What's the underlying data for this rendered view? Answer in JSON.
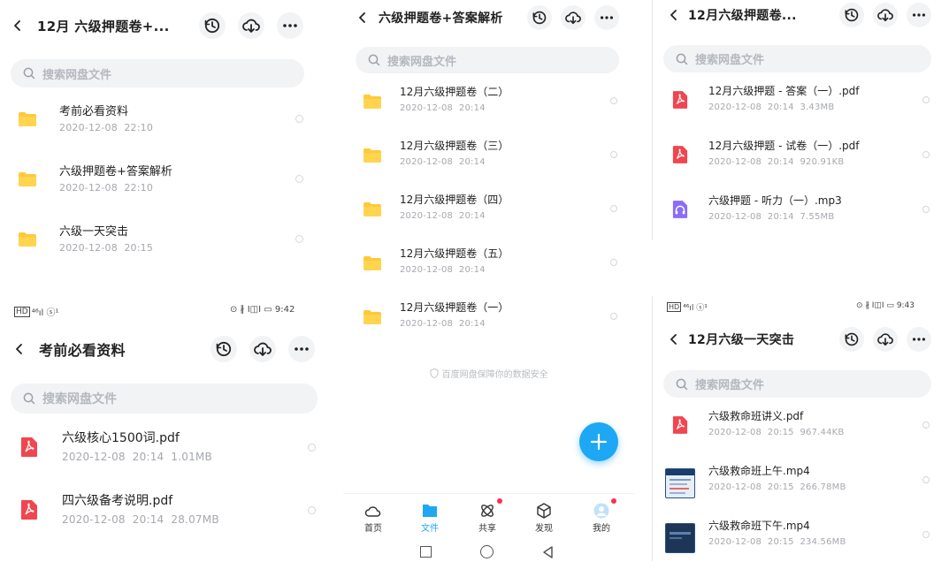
{
  "colors": {
    "accent": "#1ea7f4",
    "folder": "#ffc93c",
    "pdf": "#f0464f",
    "mp3": "#8a6cf6",
    "notify": "#ff2d55"
  },
  "search_placeholder": "搜索网盘文件",
  "p1": {
    "title": "12月 六级押题卷+...",
    "items": [
      {
        "name": "考前必看资料",
        "date": "2020-12-08",
        "time": "22:10",
        "icon": "folder-icon"
      },
      {
        "name": "六级押题卷+答案解析",
        "date": "2020-12-08",
        "time": "22:10",
        "icon": "folder-icon"
      },
      {
        "name": "六级一天突击",
        "date": "2020-12-08",
        "time": "20:15",
        "icon": "folder-icon"
      }
    ]
  },
  "p2": {
    "status_left": "HD ⁴⁶ıl ⓢ¹",
    "status_right": "⊙ ∦ I◫I ▭ 9:42",
    "time": "9:42",
    "title": "考前必看资料",
    "items": [
      {
        "name": "六级核心1500词.pdf",
        "date": "2020-12-08",
        "time": "20:14",
        "size": "1.01MB",
        "icon": "pdf-icon"
      },
      {
        "name": "四六级备考说明.pdf",
        "date": "2020-12-08",
        "time": "20:14",
        "size": "28.07MB",
        "icon": "pdf-icon"
      }
    ]
  },
  "p3": {
    "title": "六级押题卷+答案解析",
    "items": [
      {
        "name": "12月六级押题卷（二）",
        "date": "2020-12-08",
        "time": "20:14",
        "icon": "folder-icon"
      },
      {
        "name": "12月六级押题卷（三）",
        "date": "2020-12-08",
        "time": "20:14",
        "icon": "folder-icon"
      },
      {
        "name": "12月六级押题卷（四）",
        "date": "2020-12-08",
        "time": "20:14",
        "icon": "folder-icon"
      },
      {
        "name": "12月六级押题卷（五）",
        "date": "2020-12-08",
        "time": "20:14",
        "icon": "folder-icon"
      },
      {
        "name": "12月六级押题卷（一）",
        "date": "2020-12-08",
        "time": "20:14",
        "icon": "folder-icon"
      }
    ],
    "security_note": "百度网盘保障你的数据安全",
    "tabs": [
      {
        "label": "首页",
        "icon": "cloud-home-icon"
      },
      {
        "label": "文件",
        "icon": "file-folder-icon",
        "active": true
      },
      {
        "label": "共享",
        "icon": "share-atom-icon",
        "badge": true
      },
      {
        "label": "发现",
        "icon": "discover-cube-icon"
      },
      {
        "label": "我的",
        "icon": "avatar-icon",
        "badge": true
      }
    ]
  },
  "p4": {
    "title": "12月六级押题卷...",
    "items": [
      {
        "name": "12月六级押题 - 答案（一）.pdf",
        "date": "2020-12-08",
        "time": "20:14",
        "size": "3.43MB",
        "icon": "pdf-icon"
      },
      {
        "name": "12月六级押题 - 试卷（一）.pdf",
        "date": "2020-12-08",
        "time": "20:14",
        "size": "920.91KB",
        "icon": "pdf-icon"
      },
      {
        "name": "六级押题 - 听力（一）.mp3",
        "date": "2020-12-08",
        "time": "20:14",
        "size": "7.55MB",
        "icon": "audio-icon"
      }
    ]
  },
  "p5": {
    "time": "9:43",
    "title": "12月六级一天突击",
    "items": [
      {
        "name": "六级救命班讲义.pdf",
        "date": "2020-12-08",
        "time": "20:15",
        "size": "967.44KB",
        "icon": "pdf-icon"
      },
      {
        "name": "六级救命班上午.mp4",
        "date": "2020-12-08",
        "time": "20:15",
        "size": "266.78MB",
        "icon": "video-thumbnail"
      },
      {
        "name": "六级救命班下午.mp4",
        "date": "2020-12-08",
        "time": "20:15",
        "size": "234.56MB",
        "icon": "video-thumbnail"
      }
    ]
  }
}
